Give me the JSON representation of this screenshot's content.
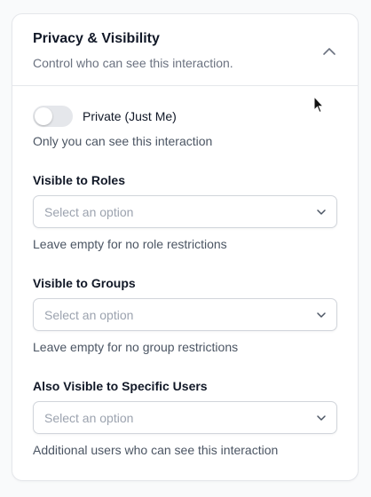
{
  "panel": {
    "title": "Privacy & Visibility",
    "subtitle": "Control who can see this interaction.",
    "collapse_icon": "chevron-up-icon"
  },
  "private_toggle": {
    "label": "Private (Just Me)",
    "checked": false,
    "help": "Only you can see this interaction"
  },
  "fields": [
    {
      "label": "Visible to Roles",
      "placeholder": "Select an option",
      "help": "Leave empty for no role restrictions"
    },
    {
      "label": "Visible to Groups",
      "placeholder": "Select an option",
      "help": "Leave empty for no group restrictions"
    },
    {
      "label": "Also Visible to Specific Users",
      "placeholder": "Select an option",
      "help": "Additional users who can see this interaction"
    }
  ],
  "colors": {
    "page_bg": "#f9fafb",
    "card_border": "#e5e7eb",
    "toggle_off": "#e5e7eb",
    "placeholder": "#9ca3af",
    "help_text": "#4b5563"
  }
}
